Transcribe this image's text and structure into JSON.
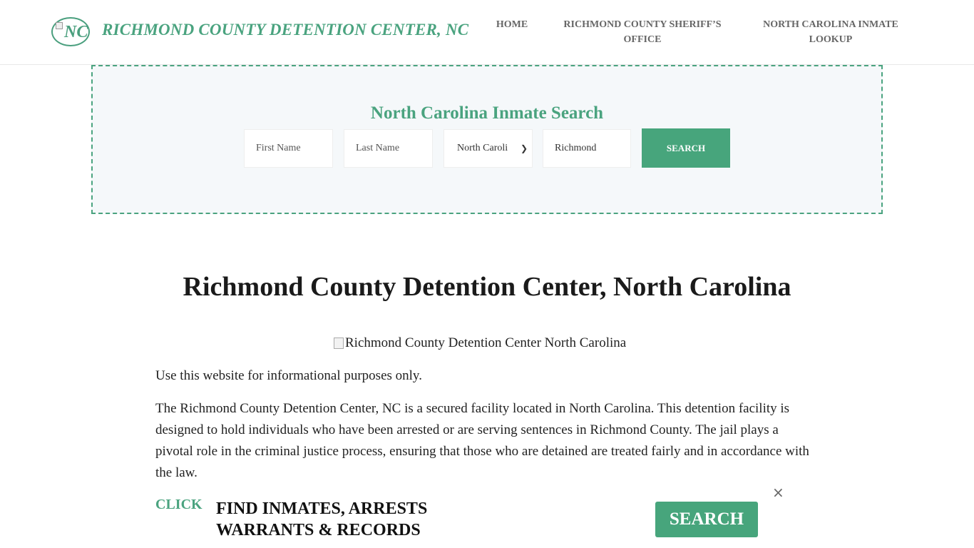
{
  "header": {
    "logo_text": "NC",
    "site_title": "RICHMOND COUNTY DETENTION CENTER, NC",
    "nav": {
      "home": "HOME",
      "sheriff_line1": "RICHMOND COUNTY SHERIFF’S",
      "sheriff_line2": "OFFICE",
      "lookup_line1": "NORTH CAROLINA INMATE",
      "lookup_line2": "LOOKUP"
    }
  },
  "search": {
    "title": "North Carolina Inmate Search",
    "first_name_placeholder": "First Name",
    "last_name_placeholder": "Last Name",
    "state_value": "North Caroli",
    "county_value": "Richmond",
    "button_label": "SEARCH"
  },
  "main": {
    "title": "Richmond County Detention Center, North Carolina",
    "image_alt": "Richmond County Detention Center North Carolina",
    "paragraph1": "Use this website for informational purposes only.",
    "paragraph2": "The Richmond County Detention Center, NC is a secured facility located in North Carolina. This detention facility is designed to hold individuals who have been arrested or are serving sentences in Richmond County. The jail plays a pivotal role in the criminal justice process, ensuring that those who are detained are treated fairly and in accordance with the law."
  },
  "banner": {
    "click_label": "CLICK",
    "line1": "FIND INMATES, ARRESTS",
    "line2": "WARRANTS & RECORDS",
    "button_label": "SEARCH",
    "close_icon": "×"
  },
  "colors": {
    "accent": "#4aa37f",
    "search_bg": "#f5f8fa"
  }
}
